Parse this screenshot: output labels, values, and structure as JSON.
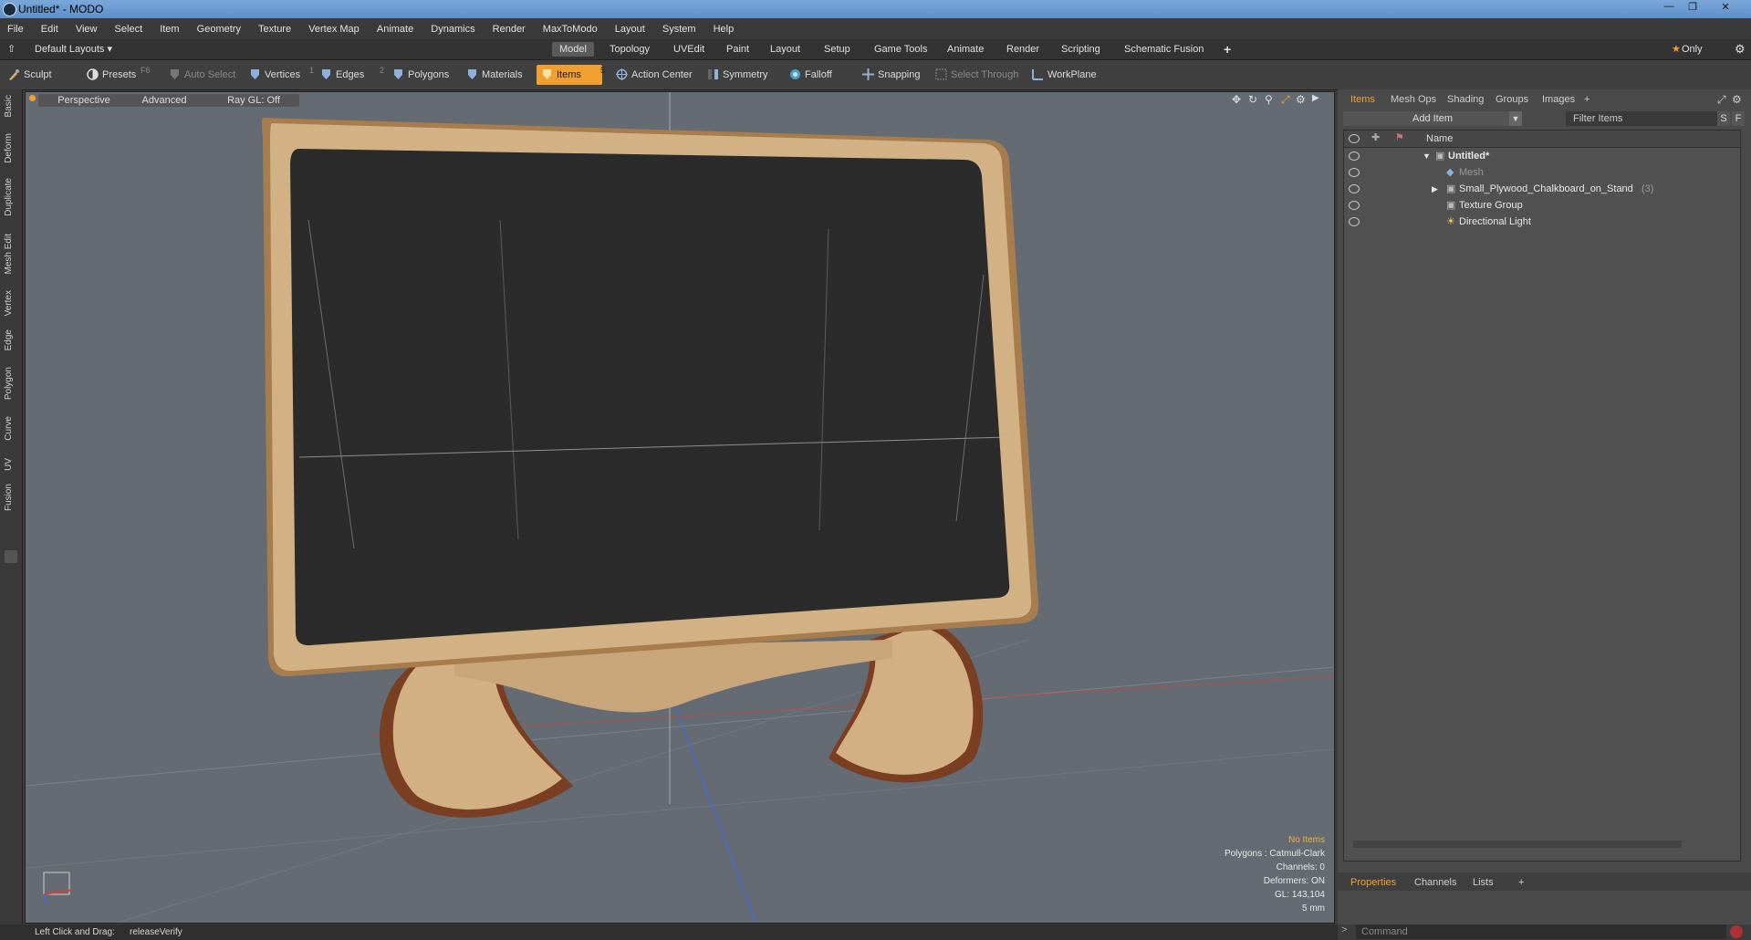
{
  "window": {
    "title": "Untitled* - MODO"
  },
  "menu": [
    "File",
    "Edit",
    "View",
    "Select",
    "Item",
    "Geometry",
    "Texture",
    "Vertex Map",
    "Animate",
    "Dynamics",
    "Render",
    "MaxToModo",
    "Layout",
    "System",
    "Help"
  ],
  "layouts": {
    "default_layouts": "Default Layouts",
    "tabs": [
      "Model",
      "Topology",
      "UVEdit",
      "Paint",
      "Layout",
      "Setup",
      "Game Tools",
      "Animate",
      "Render",
      "Scripting",
      "Schematic Fusion"
    ],
    "active_tab": "Model",
    "only_label": "Only"
  },
  "toolbar": {
    "sculpt": "Sculpt",
    "presets": "Presets",
    "presets_key": "F6",
    "auto_select": "Auto Select",
    "vertices": "Vertices",
    "vertices_num": "1",
    "edges": "Edges",
    "edges_num": "2",
    "polygons": "Polygons",
    "materials": "Materials",
    "items": "Items",
    "items_num": "5",
    "action_center": "Action Center",
    "symmetry": "Symmetry",
    "falloff": "Falloff",
    "snapping": "Snapping",
    "select_through": "Select Through",
    "workplane": "WorkPlane"
  },
  "left_tabs": [
    "Basic",
    "Deform",
    "Duplicate",
    "Mesh Edit",
    "Vertex",
    "Edge",
    "Polygon",
    "Curve",
    "UV",
    "Fusion"
  ],
  "viewport": {
    "perspective": "Perspective",
    "advanced": "Advanced",
    "ray_gl": "Ray GL: Off",
    "info": {
      "no_items": "No Items",
      "polygons": "Polygons : Catmull-Clark",
      "channels": "Channels: 0",
      "deformers": "Deformers: ON",
      "gl": "GL: 143,104",
      "unit": "5 mm"
    }
  },
  "items_panel": {
    "tabs": [
      "Items",
      "Mesh Ops",
      "Shading",
      "Groups",
      "Images"
    ],
    "active_tab": "Items",
    "add_item": "Add Item",
    "filter_placeholder": "Filter Items",
    "s_btn": "S",
    "f_btn": "F",
    "name_header": "Name",
    "tree": [
      {
        "label": "Untitled*",
        "level": 0
      },
      {
        "label": "Mesh",
        "level": 1
      },
      {
        "label": "Small_Plywood_Chalkboard_on_Stand",
        "count": "(3)",
        "level": 1
      },
      {
        "label": "Texture Group",
        "level": 1
      },
      {
        "label": "Directional Light",
        "level": 1
      }
    ]
  },
  "props_panel": {
    "tabs": [
      "Properties",
      "Channels",
      "Lists"
    ],
    "active_tab": "Properties"
  },
  "command": {
    "placeholder": "Command"
  },
  "status": {
    "label": "Left Click and Drag:",
    "value": "releaseVerify"
  }
}
